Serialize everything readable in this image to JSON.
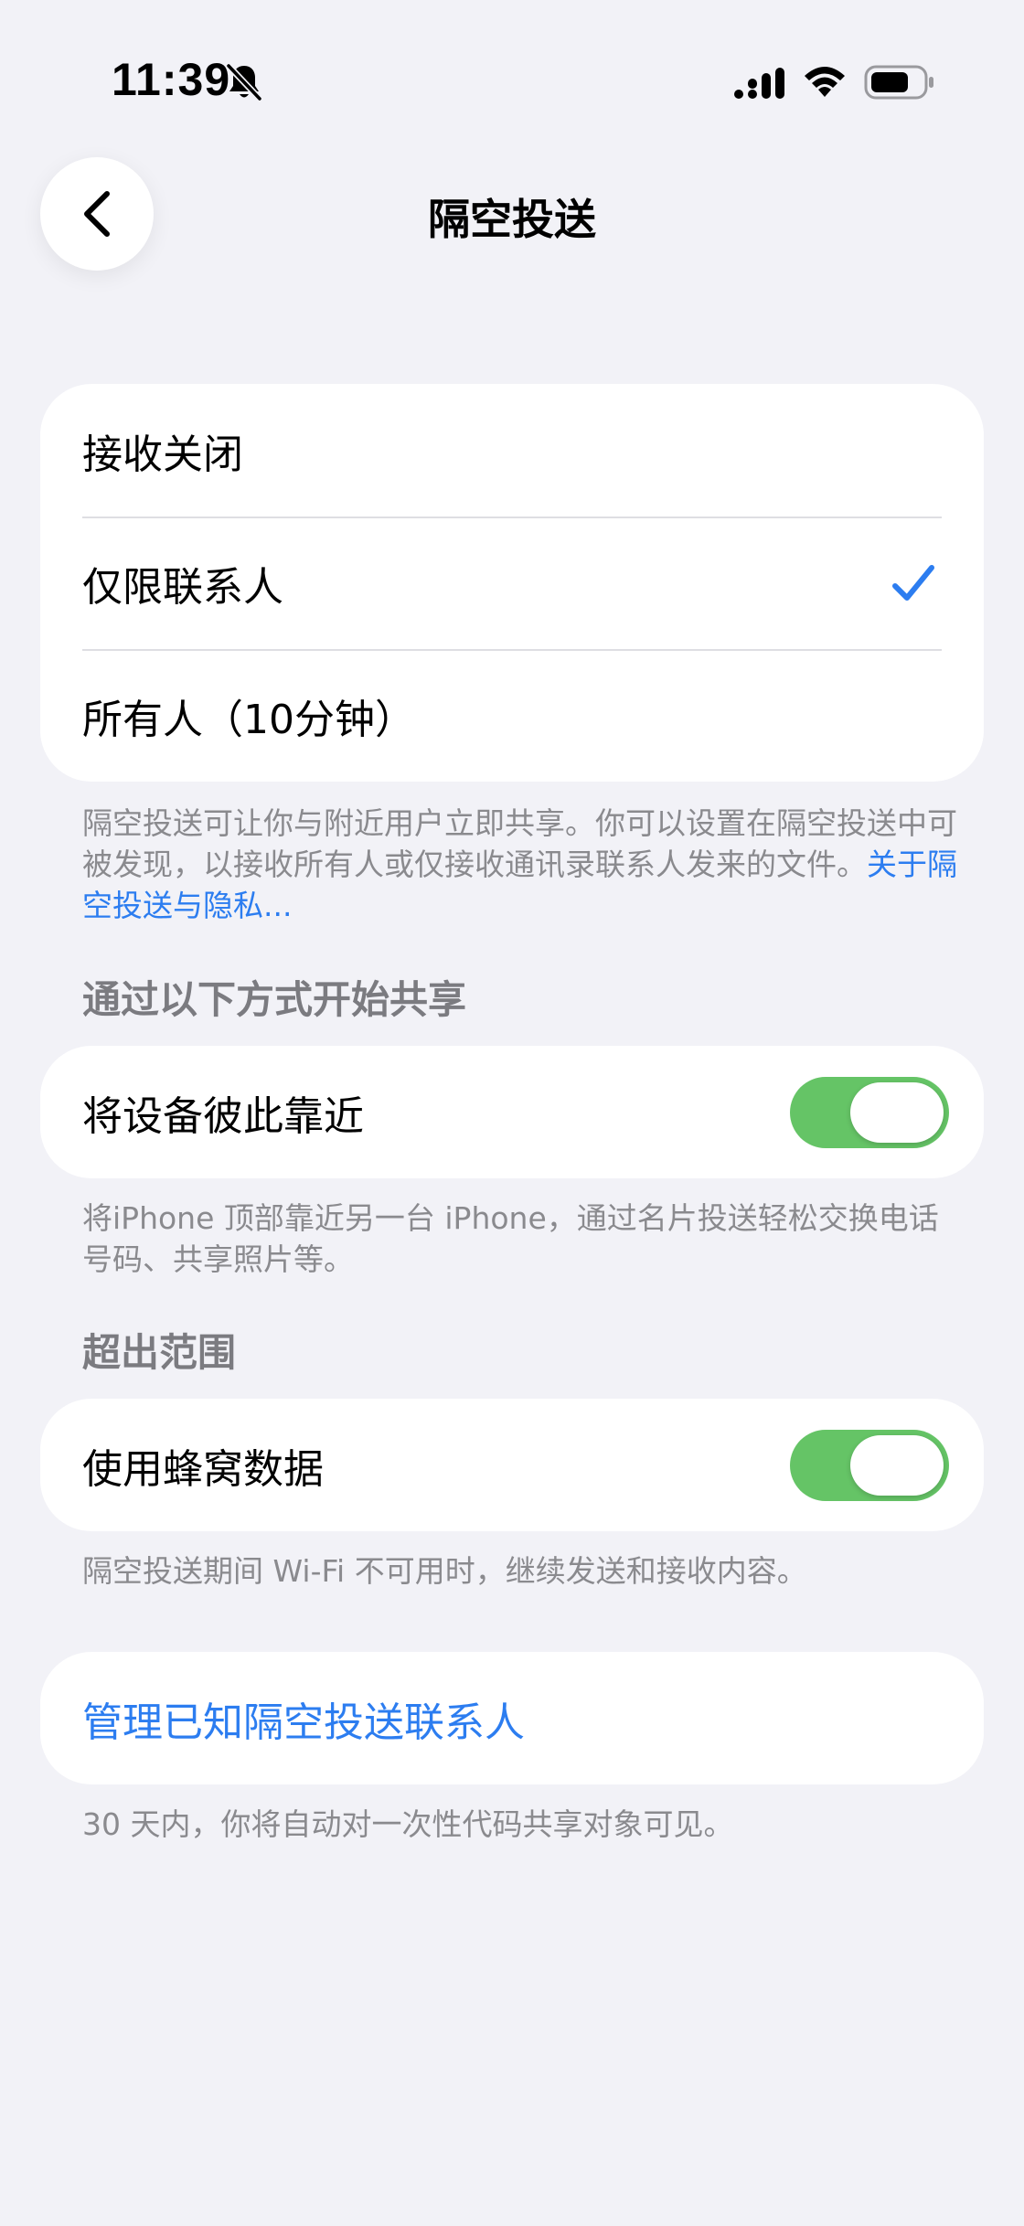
{
  "status_bar": {
    "time": "11:39"
  },
  "nav": {
    "title": "隔空投送"
  },
  "receive_options": [
    {
      "label": "接收关闭",
      "selected": false
    },
    {
      "label": "仅限联系人",
      "selected": true
    },
    {
      "label": "所有人（10分钟）",
      "selected": false
    }
  ],
  "receive_footer": {
    "text": "隔空投送可让你与附近用户立即共享。你可以设置在隔空投送中可被发现，以接收所有人或仅接收通讯录联系人发来的文件。",
    "link": "关于隔空投送与隐私..."
  },
  "start_sharing": {
    "header": "通过以下方式开始共享",
    "row_label": "将设备彼此靠近",
    "toggle_on": true,
    "footer": "将iPhone 顶部靠近另一台 iPhone，通过名片投送轻松交换电话号码、共享照片等。"
  },
  "out_of_range": {
    "header": "超出范围",
    "row_label": "使用蜂窝数据",
    "toggle_on": true,
    "footer": "隔空投送期间 Wi-Fi 不可用时，继续发送和接收内容。"
  },
  "manage": {
    "label": "管理已知隔空投送联系人",
    "footer": "30 天内，你将自动对一次性代码共享对象可见。"
  },
  "colors": {
    "accent": "#2c7df0",
    "toggle_on": "#65c466",
    "background": "#f2f2f7"
  }
}
